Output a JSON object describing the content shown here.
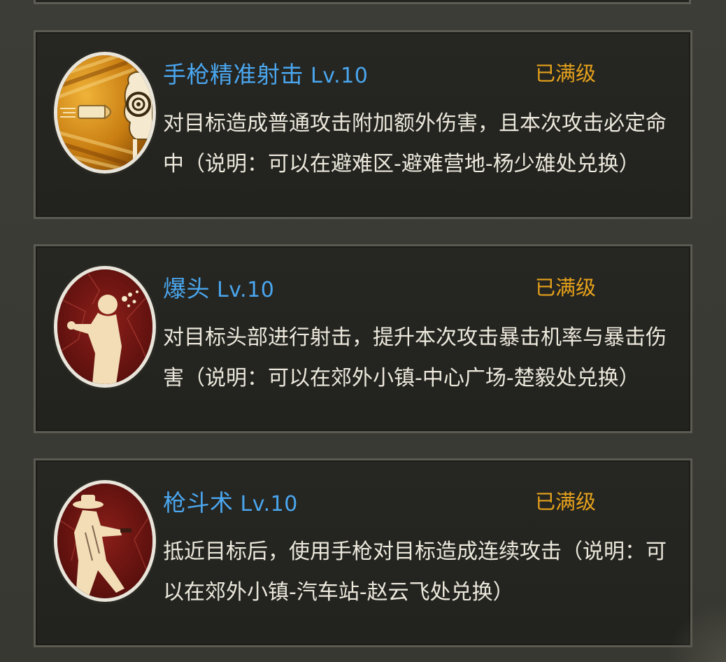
{
  "skills": [
    {
      "name": "手枪精准射击",
      "level": "Lv.10",
      "status": "已满级",
      "description": "对目标造成普通攻击附加额外伤害，且本次攻击必定命中（说明：可以在避难区-避难营地-杨少雄处兑换）",
      "icon": "target-bullet-icon"
    },
    {
      "name": "爆头",
      "level": "Lv.10",
      "status": "已满级",
      "description": "对目标头部进行射击，提升本次攻击暴击机率与暴击伤害（说明：可以在郊外小镇-中心广场-楚毅处兑换）",
      "icon": "headshot-icon"
    },
    {
      "name": "枪斗术",
      "level": "Lv.10",
      "status": "已满级",
      "description": "抵近目标后，使用手枪对目标造成连续攻击（说明：可以在郊外小镇-汽车站-赵云飞处兑换）",
      "icon": "gunfighter-icon"
    }
  ],
  "colors": {
    "name": "#4aa6ee",
    "status": "#e6a21c",
    "description": "#ece8dc",
    "card_bg": "#24241f",
    "card_border": "#5b5b52"
  }
}
